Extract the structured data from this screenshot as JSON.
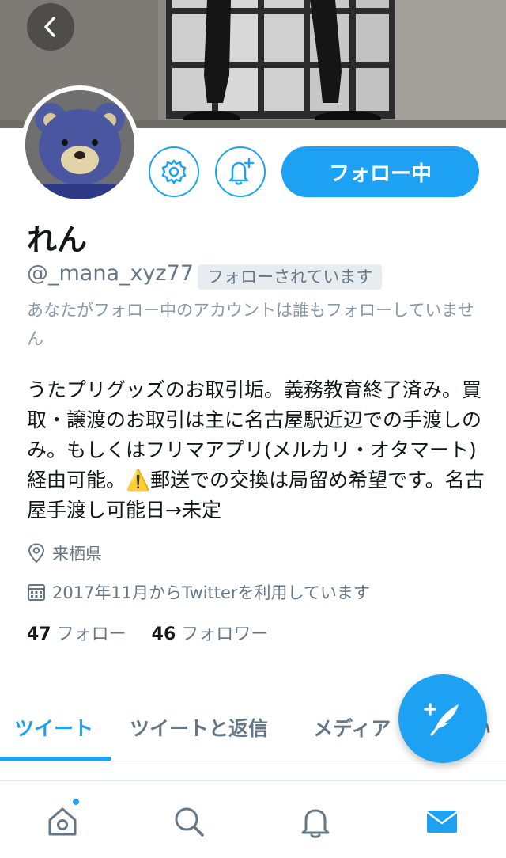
{
  "colors": {
    "accent": "#1da1f2",
    "text_primary": "#14171a",
    "text_secondary": "#657786",
    "badge_bg": "#e6ecf0"
  },
  "header": {
    "back_icon": "chevron-left-icon"
  },
  "profile": {
    "name": "れん",
    "handle": "@_mana_xyz77",
    "follows_you_badge": "フォローされています",
    "mutual_note": "あなたがフォロー中のアカウントは誰もフォローしていません",
    "bio": "うたプリグッズのお取引垢。義務教育終了済み。買取・譲渡のお取引は主に名古屋駅近辺での手渡しのみ。もしくはフリマアプリ(メルカリ・オタマート)経由可能。⚠️郵送での交換は局留め希望です。名古屋手渡し可能日→未定",
    "location": "来栖県",
    "joined": "2017年11月からTwitterを利用しています",
    "following_count": "47",
    "following_label": "フォロー",
    "followers_count": "46",
    "followers_label": "フォロワー"
  },
  "actions": {
    "settings_icon": "gear-icon",
    "notify_icon": "bell-plus-icon",
    "follow_button_label": "フォロー中"
  },
  "tabs": [
    {
      "label": "ツイート",
      "active": true
    },
    {
      "label": "ツイートと返信",
      "active": false
    },
    {
      "label": "メディア",
      "active": false
    },
    {
      "label": "い",
      "active": false
    }
  ],
  "compose_icon": "compose-tweet-icon",
  "bottom_nav": [
    {
      "icon": "home-icon",
      "has_badge": true
    },
    {
      "icon": "search-icon",
      "has_badge": false
    },
    {
      "icon": "bell-icon",
      "has_badge": false
    },
    {
      "icon": "mail-icon",
      "has_badge": false
    }
  ]
}
